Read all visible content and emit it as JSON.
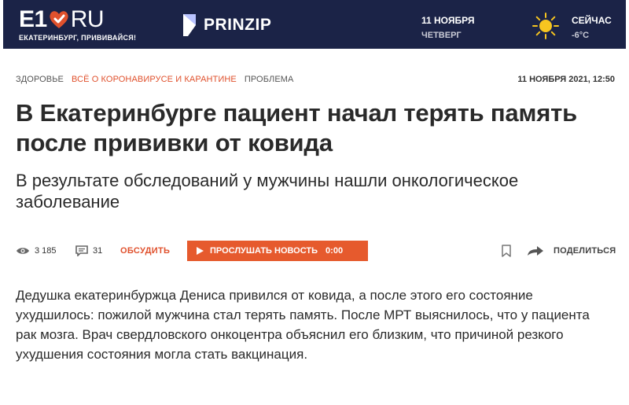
{
  "header": {
    "logo_main": "E1",
    "logo_ru": "RU",
    "logo_tagline": "ЕКАТЕРИНБУРГ, ПРИВИВАЙСЯ!",
    "partner_name": "PRINZIP",
    "date": "11 НОЯБРЯ",
    "weekday": "ЧЕТВЕРГ",
    "weather_label": "СЕЙЧАС",
    "weather_temp": "-6°C",
    "weather_icon": "sun-icon"
  },
  "breadcrumbs": [
    "ЗДОРОВЬЕ",
    "ВСЁ О КОРОНАВИРУСЕ И КАРАНТИНЕ",
    "ПРОБЛЕМА"
  ],
  "published": "11 НОЯБРЯ 2021, 12:50",
  "article": {
    "title": "В Екатеринбурге пациент начал терять память после прививки от ковида",
    "subtitle": "В результате обследований у мужчины нашли онкологическое заболевание",
    "body": "Дедушка екатеринбуржца Дениса привился от ковида, а после этого его состояние ухудшилось: пожилой мужчина стал терять память. После МРТ выяснилось, что у пациента рак мозга. Врач свердловского онкоцентра объяснил его близким, что причиной резкого ухудшения состояния могла стать вакцинация."
  },
  "stats": {
    "views": "3 185",
    "comments": "31",
    "discuss_label": "ОБСУДИТЬ",
    "listen_label": "ПРОСЛУШАТЬ НОВОСТЬ",
    "listen_time": "0:00",
    "share_label": "ПОДЕЛИТЬСЯ"
  },
  "colors": {
    "header_bg": "#1b2347",
    "accent": "#e0512d",
    "listen_bg": "#e65a2d"
  }
}
